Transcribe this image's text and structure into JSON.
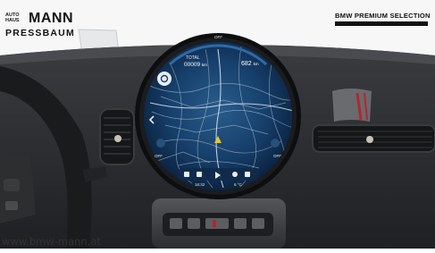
{
  "dealer_logo": {
    "prefix": "AUTO HAUS",
    "name": "MANN",
    "location": "PRESSBAUM"
  },
  "program_logo": {
    "title": "BMW PREMIUM SELECTION"
  },
  "display": {
    "status_off_top": "OFF",
    "total_label": "TOTAL",
    "total_value": "00009",
    "total_unit": "km",
    "range_value": "682",
    "range_unit": "km",
    "status_off_left": "OFF",
    "status_off_right": "OFF",
    "clock": "16:32",
    "temperature": "6 °C"
  },
  "footer": {
    "url": "www.bmw-mann.at"
  },
  "colors": {
    "map_blue": "#123a66",
    "dashboard": "#2a2b2e",
    "accent_red": "#b3262e"
  }
}
